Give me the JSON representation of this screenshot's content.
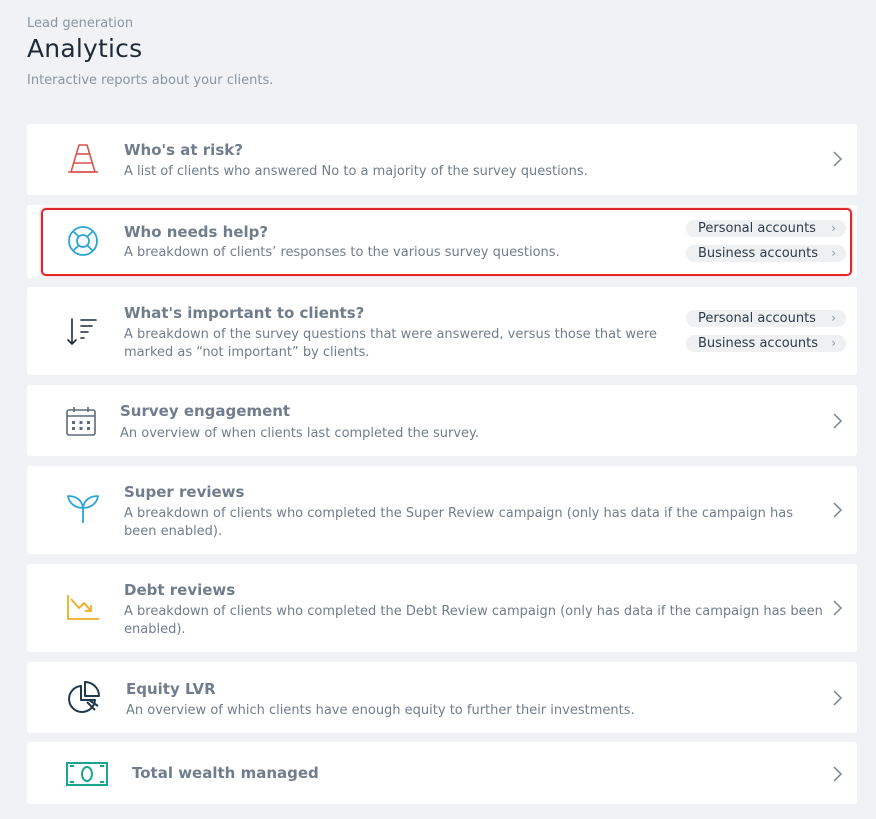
{
  "header": {
    "eyebrow": "Lead generation",
    "title": "Analytics",
    "subtitle": "Interactive reports about your clients."
  },
  "reports": [
    {
      "title": "Who's at risk?",
      "description": "A list of clients who answered No to a majority of the survey questions.",
      "icon": "traffic-cone-icon",
      "icon_color": "#d9534f"
    },
    {
      "title": "Who needs help?",
      "description": "A breakdown of clients’ responses to the various survey questions.",
      "icon": "lifebuoy-icon",
      "icon_color": "#2ba6d6",
      "links": [
        "Personal accounts",
        "Business accounts"
      ]
    },
    {
      "title": "What's important to clients?",
      "description": "A breakdown of the survey questions that were answered, versus those that were marked as “not important” by clients.",
      "icon": "sort-descending-icon",
      "icon_color": "#1f2a37",
      "links": [
        "Personal accounts",
        "Business accounts"
      ]
    },
    {
      "title": "Survey engagement",
      "description": "An overview of when clients last completed the survey.",
      "icon": "calendar-icon",
      "icon_color": "#5f6b7a"
    },
    {
      "title": "Super reviews",
      "description": "A breakdown of clients who completed the Super Review campaign (only has data if the campaign has been enabled).",
      "icon": "sprout-icon",
      "icon_color": "#2ba6d6"
    },
    {
      "title": "Debt reviews",
      "description": "A breakdown of clients who completed the Debt Review campaign (only has data if the campaign has been enabled).",
      "icon": "trending-down-chart-icon",
      "icon_color": "#f0ad1e"
    },
    {
      "title": "Equity LVR",
      "description": "An overview of which clients have enough equity to further their investments.",
      "icon": "pie-chart-icon",
      "icon_color": "#1f3a4d"
    },
    {
      "title": "Total wealth managed",
      "icon": "banknote-icon",
      "icon_color": "#1aa58f"
    }
  ],
  "colors": {
    "highlight": "#e0262d",
    "background": "#f0f2f5",
    "card": "#ffffff"
  }
}
